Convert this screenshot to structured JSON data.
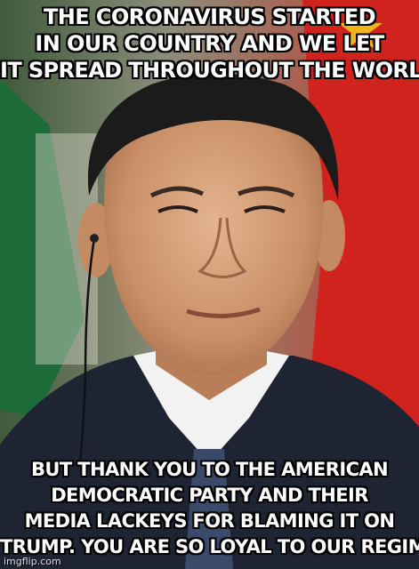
{
  "meme": {
    "top_lines": [
      "THE CORONAVIRUS STARTED",
      "IN OUR COUNTRY AND WE LET",
      "IT SPREAD THROUGHOUT THE WORLD"
    ],
    "bottom_lines": [
      "BUT THANK YOU TO THE AMERICAN",
      "DEMOCRATIC PARTY AND THEIR",
      "MEDIA LACKEYS FOR BLAMING IT ON",
      "TRUMP. YOU ARE SO LOYAL TO OUR REGIME."
    ],
    "watermark": "imgflip.com"
  },
  "colors": {
    "flag_red": "#d0231e",
    "flag_green": "#1e6b3a",
    "suit": "#1f2433",
    "shirt": "#f2f2f2",
    "text": "#ffffff"
  }
}
